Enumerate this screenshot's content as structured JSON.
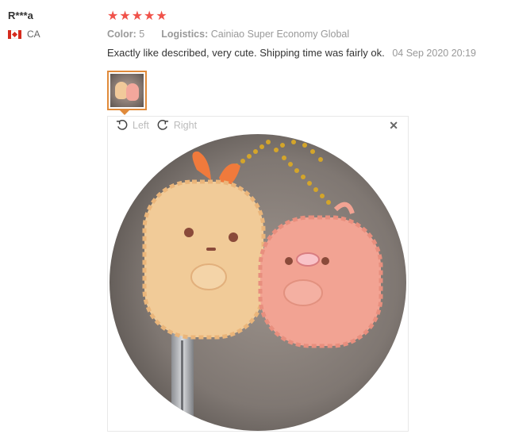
{
  "user": {
    "name": "R***a",
    "country_code": "CA"
  },
  "review": {
    "rating": 5,
    "color_label": "Color:",
    "color_value": "5",
    "logistics_label": "Logistics:",
    "logistics_value": "Cainiao Super Economy Global",
    "text": "Exactly like described, very cute. Shipping time was fairly ok.",
    "date": "04 Sep 2020 20:19"
  },
  "viewer": {
    "left_label": "Left",
    "right_label": "Right",
    "close_symbol": "✕"
  },
  "icons": [
    "canada-flag-icon",
    "star-icon",
    "rotate-left-icon",
    "rotate-right-icon",
    "close-icon"
  ],
  "colors": {
    "star": "#f0524a",
    "thumb_border": "#e08a3a"
  }
}
